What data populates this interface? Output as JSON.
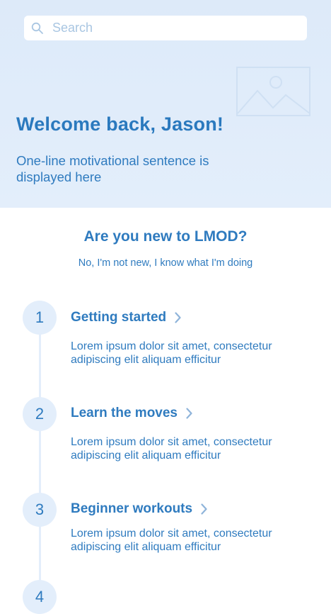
{
  "search": {
    "placeholder": "Search",
    "icon": "search-icon"
  },
  "hero": {
    "title": "Welcome back, Jason!",
    "subtitle": "One-line motivational sentence is displayed here",
    "image_icon": "image-placeholder-icon"
  },
  "onboarding": {
    "question": "Are you new to LMOD?",
    "skip_link": "No, I'm not new, I know what I'm doing"
  },
  "steps": [
    {
      "number": "1",
      "title": "Getting started",
      "description": "Lorem ipsum dolor sit amet, consectetur adipiscing elit aliquam efficitur"
    },
    {
      "number": "2",
      "title": "Learn the moves",
      "description": "Lorem ipsum dolor sit amet, consectetur adipiscing elit aliquam efficitur"
    },
    {
      "number": "3",
      "title": "Beginner workouts",
      "description": "Lorem ipsum dolor sit amet, consectetur adipiscing elit aliquam efficitur"
    },
    {
      "number": "4"
    }
  ],
  "colors": {
    "accent": "#2f7bbf",
    "hero_background": "#e3eefb",
    "placeholder": "#a9c6e2"
  }
}
